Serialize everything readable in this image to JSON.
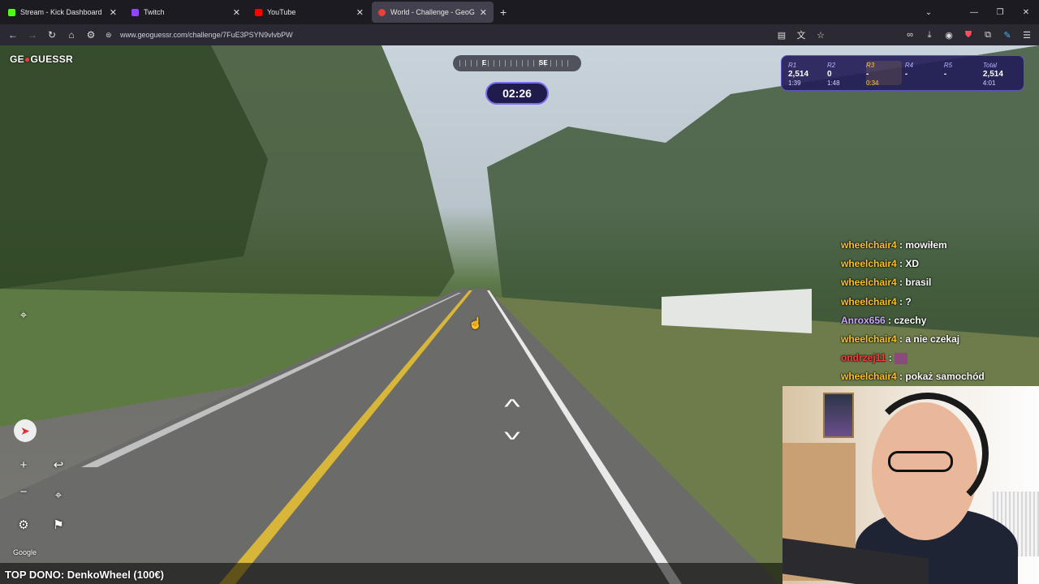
{
  "browser": {
    "tabs": [
      {
        "label": "Stream - Kick Dashboard",
        "favicon_color": "#53fc18"
      },
      {
        "label": "Twitch",
        "favicon_color": "#9146ff"
      },
      {
        "label": "YouTube",
        "favicon_color": "#ff0000"
      },
      {
        "label": "World - Challenge - GeoGuessr",
        "favicon_color": "#e8413c",
        "active": true
      }
    ],
    "url": "www.geoguessr.com/challenge/7FuE3PSYN9vlvbPW"
  },
  "game": {
    "logo_text_left": "GE",
    "logo_text_right": "GUESSR",
    "compass": {
      "e": "E",
      "se": "SE"
    },
    "timer": "02:26",
    "rounds": [
      {
        "label": "R1",
        "score": "2,514",
        "time": "1:39"
      },
      {
        "label": "R2",
        "score": "0",
        "time": "1:48"
      },
      {
        "label": "R3",
        "score": "-",
        "time": "0:34",
        "current": true
      },
      {
        "label": "R4",
        "score": "-",
        "time": ""
      },
      {
        "label": "R5",
        "score": "-",
        "time": ""
      }
    ],
    "total": {
      "label": "Total",
      "score": "2,514",
      "time": "4:01"
    },
    "attribution": "Google"
  },
  "chat": [
    {
      "user": "wheelchair4",
      "text": "mowiłem",
      "color": "#ffc31f"
    },
    {
      "user": "wheelchair4",
      "text": "XD",
      "color": "#ffc31f"
    },
    {
      "user": "wheelchair4",
      "text": "brasil",
      "color": "#ffc31f"
    },
    {
      "user": "wheelchair4",
      "text": "?",
      "color": "#ffc31f"
    },
    {
      "user": "Anrox656",
      "text": "czechy",
      "color": "#c9a7ff"
    },
    {
      "user": "wheelchair4",
      "text": "a nie czekaj",
      "color": "#ffc31f"
    },
    {
      "user": "ondrzej11",
      "text": "",
      "color": "#ff3b3b"
    },
    {
      "user": "wheelchair4",
      "text": "pokaż samochód",
      "color": "#ffc31f"
    }
  ],
  "ticker": "TOP DONO: DenkoWheel (100€)"
}
